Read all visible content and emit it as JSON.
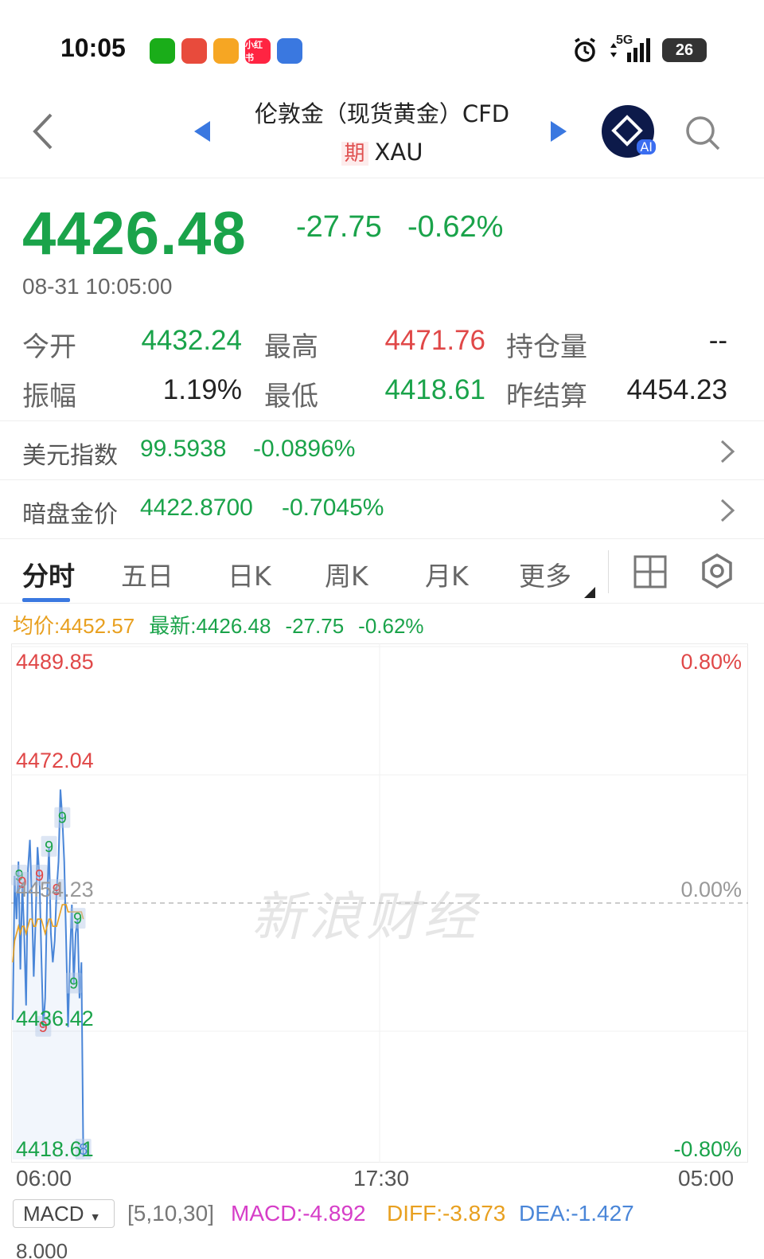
{
  "status": {
    "time": "10:05",
    "apps": [
      {
        "name": "wechat-icon",
        "color": "#1aad19",
        "label": ""
      },
      {
        "name": "game-app-icon",
        "color": "#e84b3c",
        "label": ""
      },
      {
        "name": "reward-app-icon",
        "color": "#f6a623",
        "label": ""
      },
      {
        "name": "xiaohongshu-icon",
        "color": "#ff2442",
        "label": "小红书"
      },
      {
        "name": "message-bubble-icon",
        "color": "#3a78e0",
        "label": ""
      }
    ],
    "network": "5G",
    "battery": "26"
  },
  "header": {
    "title": "伦敦金（现货黄金）CFD",
    "tag": "期",
    "symbol": "XAU",
    "ai_label": "AI"
  },
  "quote": {
    "price": "4426.48",
    "change": "-27.75",
    "change_pct": "-0.62%",
    "timestamp": "08-31 10:05:00"
  },
  "stats": {
    "open_label": "今开",
    "open": "4432.24",
    "high_label": "最高",
    "high": "4471.76",
    "oi_label": "持仓量",
    "oi": "--",
    "amp_label": "振幅",
    "amp": "1.19%",
    "low_label": "最低",
    "low": "4418.61",
    "settle_label": "昨结算",
    "settle": "4454.23"
  },
  "related": [
    {
      "label": "美元指数",
      "value": "99.5938",
      "pct": "-0.0896%"
    },
    {
      "label": "暗盘金价",
      "value": "4422.8700",
      "pct": "-0.7045%"
    }
  ],
  "tabs": [
    "分时",
    "五日",
    "日K",
    "周K",
    "月K",
    "更多"
  ],
  "legend": {
    "avg": "均价:4452.57",
    "latest": "最新:4426.48",
    "change": "-27.75",
    "pct": "-0.62%"
  },
  "chart_data": {
    "type": "line",
    "x_ticks": [
      "06:00",
      "17:30",
      "05:00"
    ],
    "y_left_ticks": [
      "4489.85",
      "4472.04",
      "4454.23",
      "4436.42",
      "4418.61"
    ],
    "y_right_ticks": [
      "0.80%",
      "0.00%",
      "-0.80%"
    ],
    "ylim": [
      4418.61,
      4489.85
    ],
    "baseline": 4454.23,
    "series": [
      {
        "name": "最新",
        "color": "#4a86d8",
        "values": [
          4438,
          4458,
          4452,
          4460,
          4445,
          4457,
          4450,
          4440,
          4459,
          4463,
          4455,
          4444,
          4452,
          4462,
          4458,
          4447,
          4437,
          4441,
          4455,
          4462,
          4450,
          4446,
          4449,
          4456,
          4460,
          4470,
          4466,
          4460,
          4449,
          4437,
          4447,
          4454,
          4443,
          4450,
          4452,
          4441,
          4446,
          4419
        ]
      },
      {
        "name": "均价",
        "color": "#e8a020",
        "values": [
          4446,
          4449,
          4450,
          4451,
          4450,
          4451,
          4451,
          4450,
          4451,
          4452,
          4452,
          4451,
          4451,
          4452,
          4452,
          4452,
          4451,
          4450,
          4451,
          4452,
          4452,
          4451,
          4451,
          4451,
          4452,
          4453,
          4454,
          4454,
          4454,
          4453,
          4453,
          4453,
          4453,
          4453,
          4453,
          4453,
          4453,
          4452
        ]
      }
    ],
    "markers": [
      {
        "label": "9",
        "index": 1,
        "color": "#1aa34a"
      },
      {
        "label": "9",
        "index": 5,
        "color": "#e04848"
      },
      {
        "label": "9",
        "index": 14,
        "color": "#e04848"
      },
      {
        "label": "9",
        "index": 16,
        "color": "#e04848"
      },
      {
        "label": "9",
        "index": 19,
        "color": "#1aa34a"
      },
      {
        "label": "9",
        "index": 23,
        "color": "#e04848"
      },
      {
        "label": "9",
        "index": 26,
        "color": "#1aa34a"
      },
      {
        "label": "9",
        "index": 32,
        "color": "#1aa34a"
      },
      {
        "label": "9",
        "index": 34,
        "color": "#1aa34a"
      },
      {
        "label": "8",
        "index": 37,
        "color": "#4a86d8"
      }
    ],
    "watermark": "新浪财经"
  },
  "macd": {
    "indicator": "MACD",
    "params": "[5,10,30]",
    "macd": "MACD:-4.892",
    "diff": "DIFF:-3.873",
    "dea": "DEA:-1.427",
    "next_axis": "8.000"
  }
}
